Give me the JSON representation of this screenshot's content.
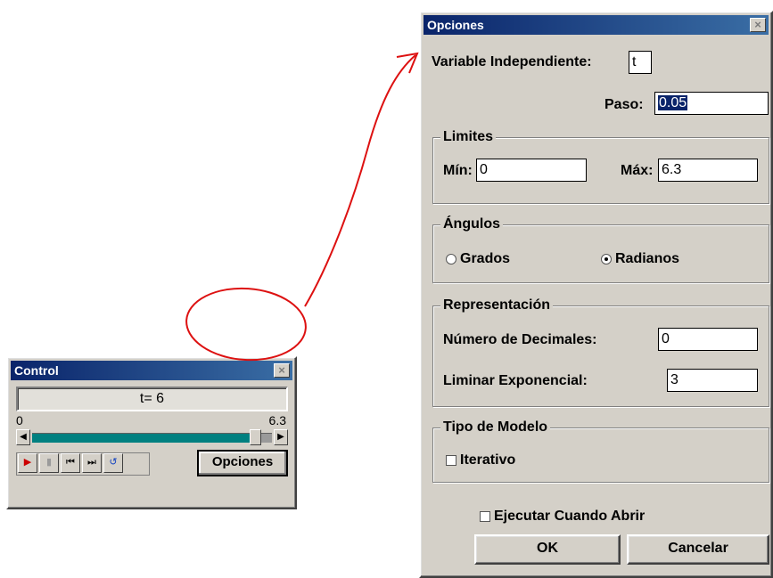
{
  "control_window": {
    "title": "Control",
    "close_glyph": "×",
    "display_text": "t= 6",
    "slider": {
      "min_label": "0",
      "max_label": "6.3",
      "value": 6,
      "min": 0,
      "max": 6.3
    },
    "playback_buttons": [
      {
        "name": "play-button",
        "icon": "play-icon",
        "glyph": "▶",
        "color": "#cc0000"
      },
      {
        "name": "pause-button",
        "icon": "pause-icon",
        "glyph": "▮",
        "color": "#9a9a9a"
      },
      {
        "name": "reset-button",
        "icon": "skip-back-icon",
        "glyph": "⏮",
        "color": "#000000"
      },
      {
        "name": "step-button",
        "icon": "step-icon",
        "glyph": "⏭",
        "color": "#000000"
      },
      {
        "name": "undo-button",
        "icon": "undo-icon",
        "glyph": "↺",
        "color": "#1040c0"
      }
    ],
    "options_button_label": "Opciones"
  },
  "options_dialog": {
    "title": "Opciones",
    "close_glyph": "×",
    "variable_label": "Variable Independiente:",
    "variable_value": "t",
    "paso_label": "Paso:",
    "paso_value": "0.05",
    "limites": {
      "title": "Limites",
      "min_label": "Mín:",
      "min_value": "0",
      "max_label": "Máx:",
      "max_value": "6.3"
    },
    "angulos": {
      "title": "Ángulos",
      "option_grados": "Grados",
      "option_radianos": "Radianos",
      "selected": "Radianos"
    },
    "representacion": {
      "title": "Representación",
      "decimales_label": "Número de Decimales:",
      "decimales_value": "0",
      "exponencial_label": "Liminar Exponencial:",
      "exponencial_value": "3"
    },
    "tipo_modelo": {
      "title": "Tipo de Modelo",
      "iterativo_label": "Iterativo",
      "iterativo_checked": false
    },
    "ejecutar_label": "Ejecutar Cuando Abrir",
    "ejecutar_checked": false,
    "ok_label": "OK",
    "cancel_label": "Cancelar"
  },
  "annotation": {
    "color": "#dd1111"
  }
}
